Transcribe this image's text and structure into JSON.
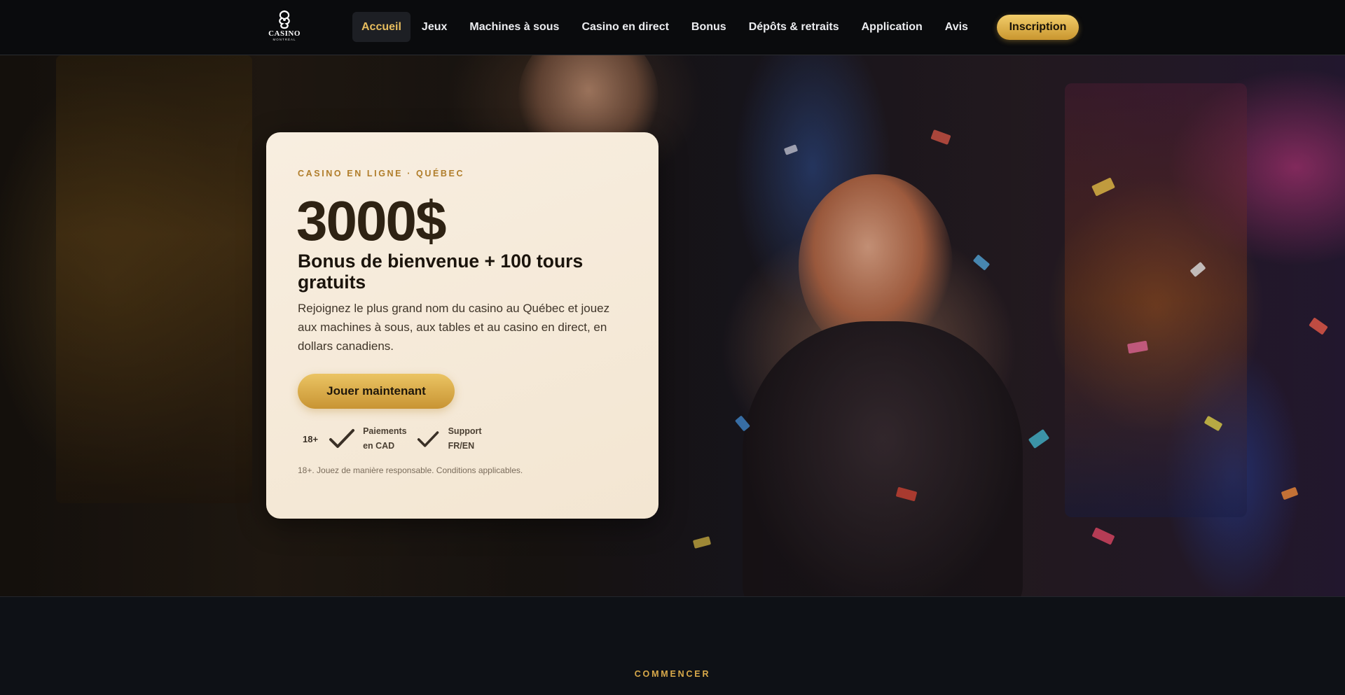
{
  "brand": {
    "logo_word": "CASINO",
    "logo_sub": "MONTRÉAL",
    "logo_icon": "swirl-emblem-icon"
  },
  "nav": {
    "items": [
      {
        "label": "Accueil",
        "active": true
      },
      {
        "label": "Jeux",
        "active": false
      },
      {
        "label": "Machines à sous",
        "active": false
      },
      {
        "label": "Casino en direct",
        "active": false
      },
      {
        "label": "Bonus",
        "active": false
      },
      {
        "label": "Dépôts & retraits",
        "active": false
      },
      {
        "label": "Application",
        "active": false
      },
      {
        "label": "Avis",
        "active": false
      }
    ],
    "cta_label": "Inscription"
  },
  "hero": {
    "eyebrow": "CASINO EN LIGNE · QUÉBEC",
    "amount": "3000$",
    "headline": "Bonus de bienvenue + 100 tours gratuits",
    "description": "Rejoignez le plus grand nom du casino au Québec et jouez aux machines à sous, aux tables et au casino en direct, en dollars canadiens.",
    "cta_label": "Jouer maintenant",
    "age_badge": "18+",
    "badges": [
      {
        "icon": "checkmark-icon",
        "line1": "Paiements",
        "line2": "en CAD"
      },
      {
        "icon": "checkmark-icon",
        "line1": "Support",
        "line2": "FR/EN"
      }
    ],
    "disclaimer": "18+. Jouez de manière responsable. Conditions applicables."
  },
  "next_section": {
    "eyebrow": "COMMENCER"
  },
  "colors": {
    "accent_gold": "#e7bd5e",
    "button_gold_top": "#f2cd6a",
    "button_gold_bottom": "#c9962f",
    "card_bg": "#f6ecdc",
    "nav_bg": "#0a0b0d",
    "page_bg": "#0e1116"
  }
}
